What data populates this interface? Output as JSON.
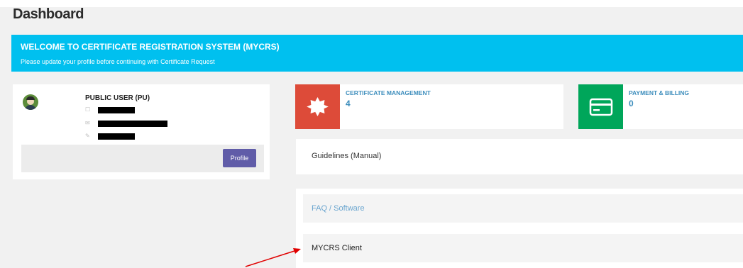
{
  "page": {
    "title": "Dashboard"
  },
  "banner": {
    "title": "WELCOME TO CERTIFICATE REGISTRATION SYSTEM (MYCRS)",
    "subtitle": "Please update your profile before continuing with Certificate Request",
    "color": "#00c0ef"
  },
  "profile": {
    "name": "PUBLIC USER (PU)",
    "rows": [
      {
        "icon": "phone-icon",
        "value": "[redacted]"
      },
      {
        "icon": "email-icon",
        "value": "[redacted]"
      },
      {
        "icon": "pencil-icon",
        "value": "[redacted]"
      }
    ],
    "button_label": "Profile"
  },
  "stats": [
    {
      "label": "CERTIFICATE MANAGEMENT",
      "value": "4",
      "icon": "certificate-badge-icon",
      "color": "#dd4b39"
    },
    {
      "label": "PAYMENT & BILLING",
      "value": "0",
      "icon": "credit-card-icon",
      "color": "#00a65a"
    }
  ],
  "links": {
    "guidelines": "Guidelines (Manual)",
    "faq": "FAQ / Software",
    "client": "MYCRS Client"
  },
  "annotation": {
    "color": "#e00000"
  }
}
